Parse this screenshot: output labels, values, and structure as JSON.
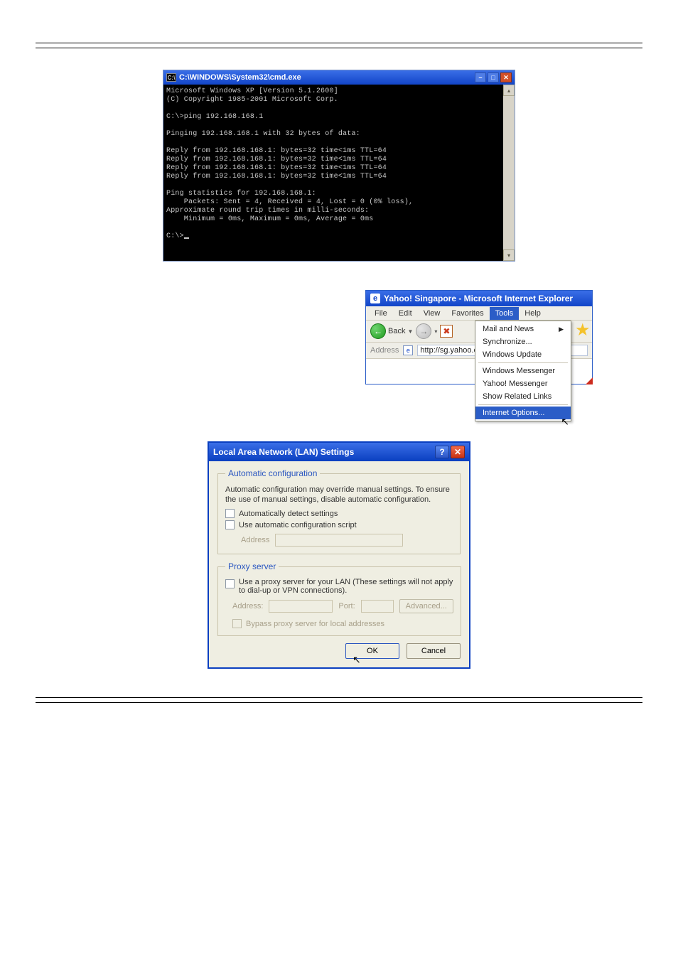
{
  "cmd": {
    "title": "C:\\WINDOWS\\System32\\cmd.exe",
    "iconGlyph": "C:\\",
    "lines": [
      "Microsoft Windows XP [Version 5.1.2600]",
      "(C) Copyright 1985-2001 Microsoft Corp.",
      "",
      "C:\\>ping 192.168.168.1",
      "",
      "Pinging 192.168.168.1 with 32 bytes of data:",
      "",
      "Reply from 192.168.168.1: bytes=32 time<1ms TTL=64",
      "Reply from 192.168.168.1: bytes=32 time<1ms TTL=64",
      "Reply from 192.168.168.1: bytes=32 time<1ms TTL=64",
      "Reply from 192.168.168.1: bytes=32 time<1ms TTL=64",
      "",
      "Ping statistics for 192.168.168.1:",
      "    Packets: Sent = 4, Received = 4, Lost = 0 (0% loss),",
      "Approximate round trip times in milli-seconds:",
      "    Minimum = 0ms, Maximum = 0ms, Average = 0ms",
      "",
      "C:\\>_"
    ],
    "upGlyph": "▴",
    "downGlyph": "▾"
  },
  "ie": {
    "title": "Yahoo! Singapore - Microsoft Internet Explorer",
    "iconGlyph": "e",
    "starGlyph": "★",
    "menus": {
      "file": "File",
      "edit": "Edit",
      "view": "View",
      "favorites": "Favorites",
      "tools": "Tools",
      "help": "Help"
    },
    "backLabel": "Back",
    "backArrow": "←",
    "fwdArrow": "→",
    "dropGlyph": "▼",
    "stopGlyph": "✖",
    "addressLabel": "Address",
    "pageIconGlyph": "e",
    "url": "http://sg.yahoo.com",
    "toolsMenu": {
      "mailAndNews": "Mail and News",
      "submenuGlyph": "▶",
      "synchronize": "Synchronize...",
      "windowsUpdate": "Windows Update",
      "windowsMessenger": "Windows Messenger",
      "yahooMessenger": "Yahoo! Messenger",
      "showRelatedLinks": "Show Related Links",
      "internetOptions": "Internet Options..."
    },
    "cursorGlyph": "↖"
  },
  "lan": {
    "title": "Local Area Network (LAN) Settings",
    "helpGlyph": "?",
    "closeGlyph": "✕",
    "autoLegend": "Automatic configuration",
    "autoText": "Automatic configuration may override manual settings.  To ensure the use of manual settings, disable automatic configuration.",
    "autoDetect": "Automatically detect settings",
    "autoScript": "Use automatic configuration script",
    "addressLabel": "Address",
    "proxyLegend": "Proxy server",
    "proxyText": "Use a proxy server for your LAN (These settings will not apply to dial-up or VPN connections).",
    "proxyAddressLabel": "Address:",
    "proxyPortLabel": "Port:",
    "advancedLabel": "Advanced...",
    "bypassLabel": "Bypass proxy server for local addresses",
    "okLabel": "OK",
    "cancelLabel": "Cancel",
    "cursorGlyph": "↖"
  }
}
